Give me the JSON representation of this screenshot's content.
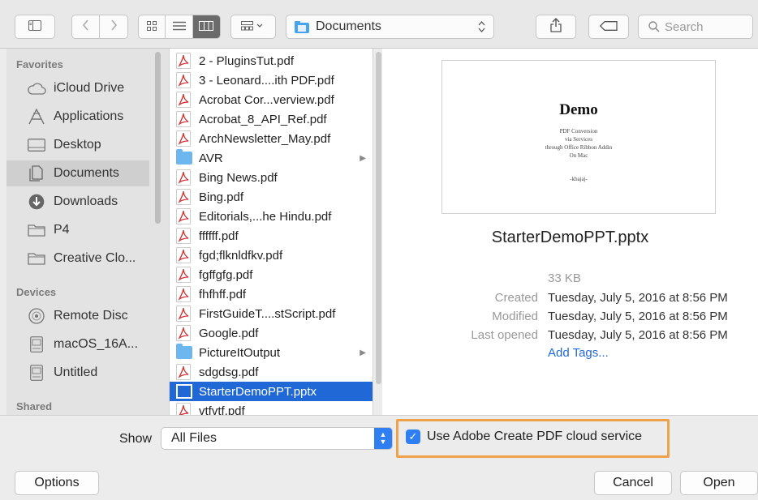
{
  "toolbar": {
    "path_label": "Documents",
    "search_placeholder": "Search"
  },
  "sidebar": {
    "favorites_header": "Favorites",
    "favorites": [
      {
        "label": "iCloud Drive",
        "icon": "cloud-icon"
      },
      {
        "label": "Applications",
        "icon": "applications-icon"
      },
      {
        "label": "Desktop",
        "icon": "desktop-icon"
      },
      {
        "label": "Documents",
        "icon": "documents-icon",
        "selected": true
      },
      {
        "label": "Downloads",
        "icon": "downloads-icon"
      },
      {
        "label": "P4",
        "icon": "folder-icon"
      },
      {
        "label": "Creative Clo...",
        "icon": "folder-icon"
      }
    ],
    "devices_header": "Devices",
    "devices": [
      {
        "label": "Remote Disc",
        "icon": "disc-icon"
      },
      {
        "label": "macOS_16A...",
        "icon": "drive-icon"
      },
      {
        "label": "Untitled",
        "icon": "drive-icon"
      }
    ],
    "shared_header": "Shared"
  },
  "files": [
    {
      "name": "2 - PluginsTut.pdf",
      "type": "pdf"
    },
    {
      "name": "3 - Leonard....ith PDF.pdf",
      "type": "pdf"
    },
    {
      "name": "Acrobat Cor...verview.pdf",
      "type": "pdf"
    },
    {
      "name": "Acrobat_8_API_Ref.pdf",
      "type": "pdf"
    },
    {
      "name": "ArchNewsletter_May.pdf",
      "type": "pdf"
    },
    {
      "name": "AVR",
      "type": "folder"
    },
    {
      "name": "Bing News.pdf",
      "type": "pdf"
    },
    {
      "name": "Bing.pdf",
      "type": "pdf"
    },
    {
      "name": "Editorials,...he Hindu.pdf",
      "type": "pdf"
    },
    {
      "name": "ffffff.pdf",
      "type": "pdf"
    },
    {
      "name": "fgd;flknldfkv.pdf",
      "type": "pdf"
    },
    {
      "name": "fgffgfg.pdf",
      "type": "pdf"
    },
    {
      "name": "fhfhff.pdf",
      "type": "pdf"
    },
    {
      "name": "FirstGuideT....stScript.pdf",
      "type": "pdf"
    },
    {
      "name": "Google.pdf",
      "type": "pdf"
    },
    {
      "name": "PictureItOutput",
      "type": "folder"
    },
    {
      "name": "sdgdsg.pdf",
      "type": "pdf"
    },
    {
      "name": "StarterDemoPPT.pptx",
      "type": "pptx",
      "selected": true
    },
    {
      "name": "vtfvtf.pdf",
      "type": "pdf"
    }
  ],
  "preview": {
    "thumb_title": "Demo",
    "thumb_lines": [
      "PDF Conversion",
      "via Services",
      "through Office Ribbon Addin",
      "On Mac"
    ],
    "thumb_author": "-kbajaj-",
    "file_name": "StarterDemoPPT.pptx",
    "size": "33 KB",
    "created_label": "Created",
    "created_value": "Tuesday, July 5, 2016 at 8:56 PM",
    "modified_label": "Modified",
    "modified_value": "Tuesday, July 5, 2016 at 8:56 PM",
    "last_opened_label": "Last opened",
    "last_opened_value": "Tuesday, July 5, 2016 at 8:56 PM",
    "add_tags": "Add Tags..."
  },
  "accessory": {
    "show_label": "Show",
    "show_value": "All Files",
    "checkbox_label": "Use Adobe Create PDF cloud service",
    "checkbox_checked": true,
    "highlight_color": "#f0a24b"
  },
  "buttons": {
    "options": "Options",
    "cancel": "Cancel",
    "open": "Open"
  },
  "colors": {
    "accent": "#1f68d6",
    "pdf_red": "#d0312d",
    "folder_blue": "#6cb7f0"
  }
}
